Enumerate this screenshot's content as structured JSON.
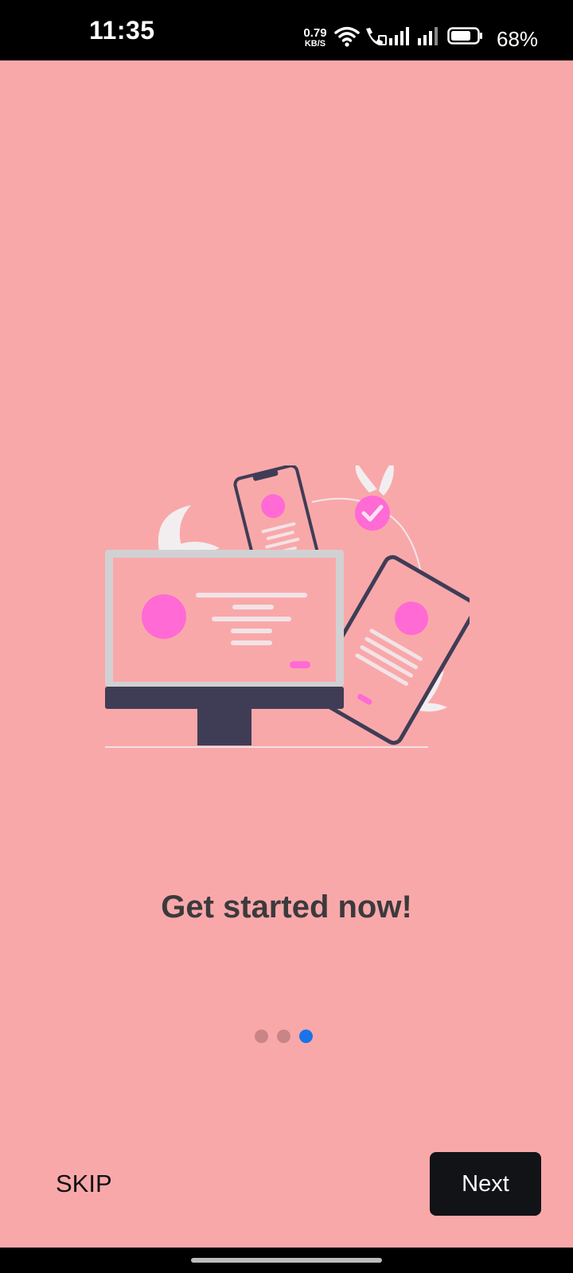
{
  "status_bar": {
    "time": "11:35",
    "net_speed_value": "0.79",
    "net_speed_unit": "KB/S",
    "battery_percent": "68%",
    "icons": [
      "wifi-icon",
      "wifi-calling-icon",
      "signal-icon",
      "signal-icon",
      "battery-icon"
    ]
  },
  "onboarding": {
    "title": "Get started now!",
    "page_count": 3,
    "active_page": 3,
    "illustration_icons": [
      "monitor-icon",
      "phone-icon",
      "tablet-icon",
      "check-badge-icon",
      "leaf-icon"
    ]
  },
  "actions": {
    "skip_label": "SKIP",
    "next_label": "Next"
  },
  "colors": {
    "background": "#f9a8aa",
    "accent_pink": "#ff6ad5",
    "dark": "#3f3d56",
    "dot_active": "#1a73e8",
    "dot_inactive": "#c98586",
    "button_dark": "#121316"
  }
}
